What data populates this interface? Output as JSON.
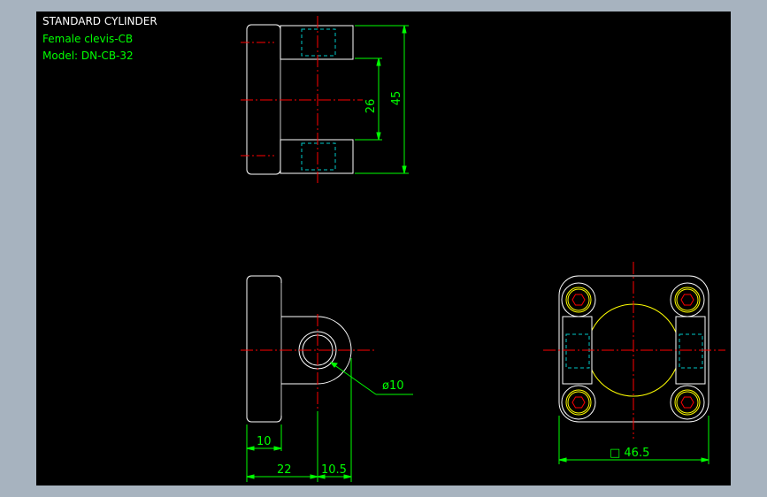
{
  "header": {
    "line1": "STANDARD CYLINDER",
    "line2": "Female clevis-CB",
    "line3": "Model: DN-CB-32"
  },
  "dimensions": {
    "d26": "26",
    "d45": "45",
    "dia10": "ø10",
    "d10": "10",
    "d22": "22",
    "d10_5": "10.5",
    "sq46_5": "□ 46.5"
  },
  "colors": {
    "background": "#000000",
    "frame": "#a7b3bf",
    "outline": "#ffffff",
    "dimension": "#00ff00",
    "centerline": "#ff0000",
    "hidden": "#00c8c8",
    "bolt": "#ffff00"
  }
}
